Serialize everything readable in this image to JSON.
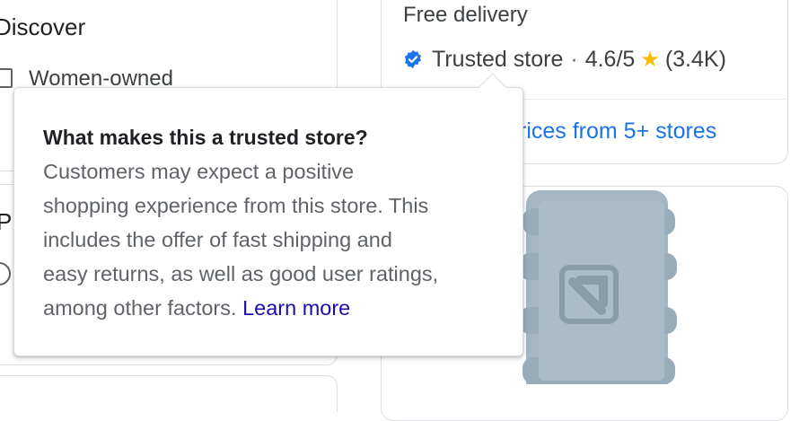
{
  "filters": {
    "discover_heading": "Discover",
    "women_owned_label": "Women-owned",
    "price_heading_partial": "Pr"
  },
  "product": {
    "delivery": "Free delivery",
    "trusted_label": "Trusted store",
    "rating": "4.6/5",
    "review_count": "(3.4K)",
    "prices_link": "rices from 5+ stores"
  },
  "tooltip": {
    "title": "What makes this a trusted store?",
    "body_lines": [
      "Customers may expect a positive",
      "shopping experience from this store. This",
      "includes the offer of fast shipping and",
      "easy returns, as well as good user ratings,",
      "among other factors."
    ],
    "learn_more": "Learn more"
  },
  "icons": {
    "trusted_badge": "verified-badge-icon",
    "star": "star-icon",
    "product_image": "foam-roller-image"
  },
  "colors": {
    "link": "#1a73e8",
    "learn_more": "#1a0dab",
    "badge": "#1a73e8",
    "star": "#fbbc04",
    "product": "#9fb3bf"
  }
}
